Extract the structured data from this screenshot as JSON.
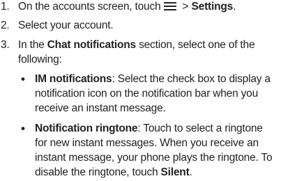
{
  "steps": [
    {
      "num": "1.",
      "pre": "On the accounts screen, touch",
      "icon": "menu-icon",
      "post": " > ",
      "bold": "Settings",
      "end": "."
    },
    {
      "num": "2.",
      "text": "Select your account."
    },
    {
      "num": "3.",
      "pre": "In the ",
      "bold": "Chat notifications",
      "post": " section, select one of the",
      "line2": "following:"
    }
  ],
  "bullets": [
    {
      "bold": "IM notifications",
      "lines": [
        ": Select the check box to display a",
        "notification icon on the notification bar when you",
        "receive an instant message."
      ]
    },
    {
      "bold": "Notification ringtone",
      "lines": [
        ": Touch to select a ringtone",
        "for new instant messages. When you receive an",
        "instant message, your phone plays the ringtone. To",
        "disable the ringtone, touch "
      ],
      "end_bold": "Silent",
      "end": "."
    }
  ]
}
